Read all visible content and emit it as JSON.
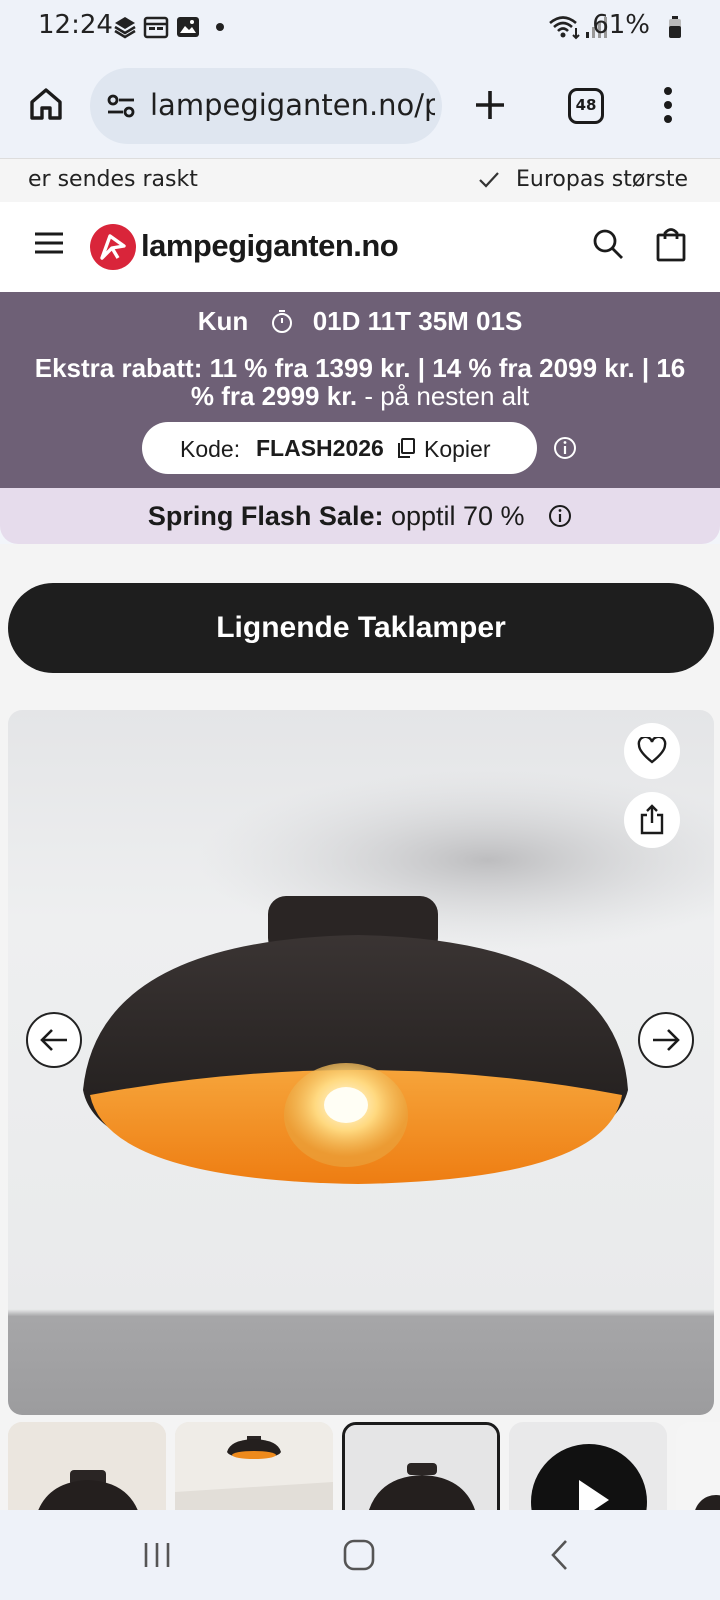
{
  "status_bar": {
    "time": "12:24",
    "battery": "61%",
    "icons": [
      "layers-icon",
      "calendar-icon",
      "image-icon",
      "dot-icon",
      "wifi-icon",
      "signal-icon",
      "battery-icon"
    ]
  },
  "browser": {
    "url": "lampegiganten.no/p...",
    "tab_count": "48"
  },
  "usp": {
    "item_left": "er sendes raskt",
    "item_right": "Europas største"
  },
  "header": {
    "logo": "lampegiganten.no"
  },
  "promo": {
    "countdown_prefix": "Kun",
    "countdown": "01D 11T 35M 01S",
    "discount_bold": "Ekstra rabatt: 11 % fra 1399 kr. | 14 % fra 2099 kr. | 16 % fra 2999 kr.",
    "discount_light": " - på nesten alt",
    "code_label": "Kode:",
    "code_value": "FLASH2026",
    "copy_label": "Kopier"
  },
  "flash_sale": {
    "bold": "Spring Flash Sale:",
    "text": " opptil 70 %"
  },
  "main": {
    "similar_button": "Lignende Taklamper"
  },
  "colors": {
    "brand_red": "#d9253a",
    "promo_purple": "#6e6076",
    "flash_lilac": "#e6dcec",
    "lamp_orange": "#f08a1c"
  }
}
